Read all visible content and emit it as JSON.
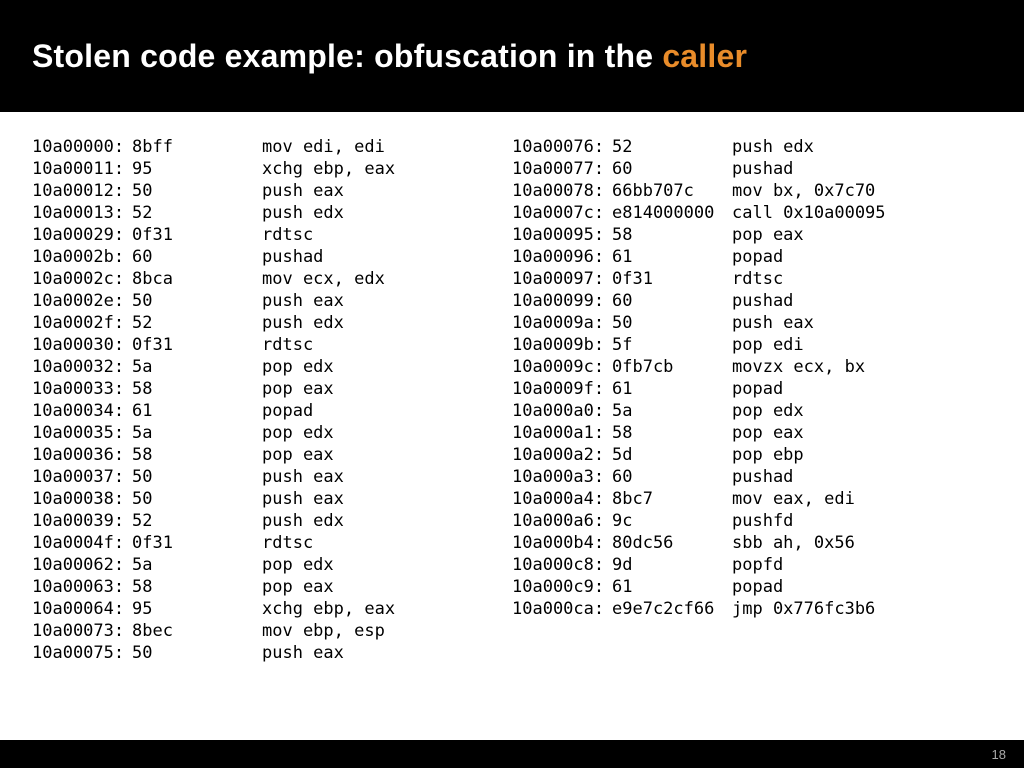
{
  "header": {
    "title_prefix": "Stolen code example: obfuscation in the ",
    "title_highlight": "caller"
  },
  "footer": {
    "page_number": "18"
  },
  "left_column": [
    {
      "addr": "10a00000:",
      "bytes": "8bff",
      "asm": "mov edi, edi"
    },
    {
      "addr": "10a00011:",
      "bytes": "95",
      "asm": "xchg ebp, eax"
    },
    {
      "addr": "10a00012:",
      "bytes": "50",
      "asm": "push eax"
    },
    {
      "addr": "10a00013:",
      "bytes": "52",
      "asm": "push edx"
    },
    {
      "addr": "10a00029:",
      "bytes": "0f31",
      "asm": "rdtsc"
    },
    {
      "addr": "10a0002b:",
      "bytes": "60",
      "asm": "pushad"
    },
    {
      "addr": "10a0002c:",
      "bytes": "8bca",
      "asm": "mov ecx, edx"
    },
    {
      "addr": "10a0002e:",
      "bytes": "50",
      "asm": "push eax"
    },
    {
      "addr": "10a0002f:",
      "bytes": "52",
      "asm": "push edx"
    },
    {
      "addr": "10a00030:",
      "bytes": "0f31",
      "asm": "rdtsc"
    },
    {
      "addr": "10a00032:",
      "bytes": "5a",
      "asm": "pop edx"
    },
    {
      "addr": "10a00033:",
      "bytes": "58",
      "asm": "pop eax"
    },
    {
      "addr": "10a00034:",
      "bytes": "61",
      "asm": "popad"
    },
    {
      "addr": "10a00035:",
      "bytes": "5a",
      "asm": "pop edx"
    },
    {
      "addr": "10a00036:",
      "bytes": "58",
      "asm": "pop eax"
    },
    {
      "addr": "10a00037:",
      "bytes": "50",
      "asm": "push eax"
    },
    {
      "addr": "10a00038:",
      "bytes": "50",
      "asm": "push eax"
    },
    {
      "addr": "10a00039:",
      "bytes": "52",
      "asm": "push edx"
    },
    {
      "addr": "10a0004f:",
      "bytes": "0f31",
      "asm": "rdtsc"
    },
    {
      "addr": "10a00062:",
      "bytes": "5a",
      "asm": "pop edx"
    },
    {
      "addr": "10a00063:",
      "bytes": "58",
      "asm": "pop eax"
    },
    {
      "addr": "10a00064:",
      "bytes": "95",
      "asm": "xchg ebp, eax"
    },
    {
      "addr": "10a00073:",
      "bytes": "8bec",
      "asm": "mov ebp, esp"
    },
    {
      "addr": "10a00075:",
      "bytes": "50",
      "asm": "push eax"
    }
  ],
  "right_column": [
    {
      "addr": "10a00076:",
      "bytes": "52",
      "asm": "push edx"
    },
    {
      "addr": "10a00077:",
      "bytes": "60",
      "asm": "pushad"
    },
    {
      "addr": "10a00078:",
      "bytes": "66bb707c",
      "asm": "mov bx, 0x7c70"
    },
    {
      "addr": "10a0007c:",
      "bytes": "e814000000",
      "asm": "call 0x10a00095"
    },
    {
      "addr": "10a00095:",
      "bytes": "58",
      "asm": "pop eax"
    },
    {
      "addr": "10a00096:",
      "bytes": "61",
      "asm": "popad"
    },
    {
      "addr": "10a00097:",
      "bytes": "0f31",
      "asm": "rdtsc"
    },
    {
      "addr": "10a00099:",
      "bytes": "60",
      "asm": "pushad"
    },
    {
      "addr": "10a0009a:",
      "bytes": "50",
      "asm": "push eax"
    },
    {
      "addr": "10a0009b:",
      "bytes": "5f",
      "asm": "pop edi"
    },
    {
      "addr": "10a0009c:",
      "bytes": "0fb7cb",
      "asm": "movzx ecx, bx"
    },
    {
      "addr": "10a0009f:",
      "bytes": "61",
      "asm": "popad"
    },
    {
      "addr": "10a000a0:",
      "bytes": "5a",
      "asm": "pop edx"
    },
    {
      "addr": "10a000a1:",
      "bytes": "58",
      "asm": "pop eax"
    },
    {
      "addr": "10a000a2:",
      "bytes": "5d",
      "asm": "pop ebp"
    },
    {
      "addr": "10a000a3:",
      "bytes": "60",
      "asm": "pushad"
    },
    {
      "addr": "10a000a4:",
      "bytes": "8bc7",
      "asm": "mov eax, edi"
    },
    {
      "addr": "10a000a6:",
      "bytes": "9c",
      "asm": "pushfd"
    },
    {
      "addr": "10a000b4:",
      "bytes": "80dc56",
      "asm": "sbb ah, 0x56"
    },
    {
      "addr": "10a000c8:",
      "bytes": "9d",
      "asm": "popfd"
    },
    {
      "addr": "10a000c9:",
      "bytes": "61",
      "asm": "popad"
    },
    {
      "addr": "10a000ca:",
      "bytes": "e9e7c2cf66",
      "asm": "jmp 0x776fc3b6"
    }
  ]
}
